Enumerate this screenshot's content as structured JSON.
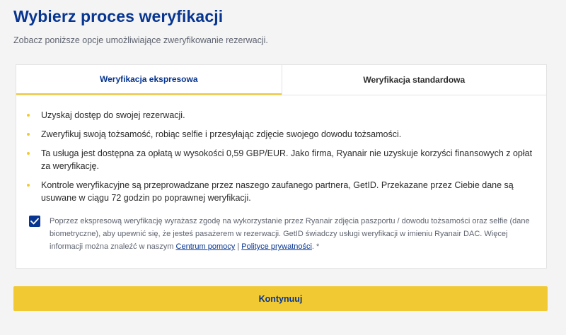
{
  "header": {
    "title": "Wybierz proces weryfikacji",
    "subtitle": "Zobacz poniższe opcje umożliwiające zweryfikowanie rezerwacji."
  },
  "tabs": [
    {
      "label": "Weryfikacja ekspresowa",
      "active": true
    },
    {
      "label": "Weryfikacja standardowa",
      "active": false
    }
  ],
  "bullets": [
    "Uzyskaj dostęp do swojej rezerwacji.",
    "Zweryfikuj swoją tożsamość, robiąc selfie i przesyłając zdjęcie swojego dowodu tożsamości.",
    "Ta usługa jest dostępna za opłatą w wysokości 0,59 GBP/EUR. Jako firma, Ryanair nie uzyskuje korzyści finansowych z opłat za weryfikację.",
    "Kontrole weryfikacyjne są przeprowadzane przez naszego zaufanego partnera, GetID. Przekazane przez Ciebie dane są usuwane w ciągu 72 godzin po poprawnej weryfikacji."
  ],
  "consent": {
    "checked": true,
    "text": "Poprzez ekspresową weryfikację wyrażasz zgodę na wykorzystanie przez Ryanair zdjęcia paszportu / dowodu tożsamości oraz selfie (dane biometryczne), aby upewnić się, że jesteś pasażerem w rezerwacji. GetID świadczy usługi weryfikacji w imieniu Ryanair DAC. Więcej informacji można znaleźć w naszym",
    "help_link": "Centrum pomocy",
    "separator": "|",
    "privacy_link": "Polityce prywatności",
    "suffix": ". *"
  },
  "actions": {
    "continue_label": "Kontynuuj"
  },
  "colors": {
    "brand_blue": "#073590",
    "accent_yellow": "#f1c933",
    "background": "#f4f4f4"
  }
}
